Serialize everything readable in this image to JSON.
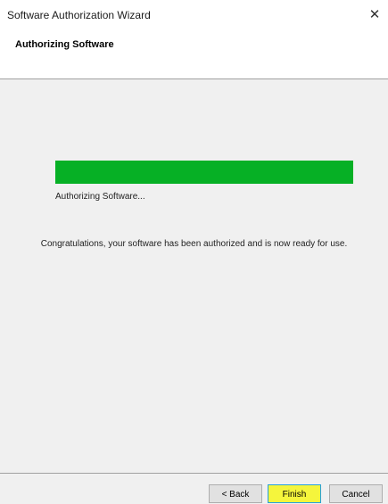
{
  "window": {
    "title": "Software Authorization Wizard",
    "close_glyph": "✕"
  },
  "header": {
    "title": "Authorizing Software"
  },
  "progress": {
    "value_percent": 100,
    "fill_color": "#06b025"
  },
  "status": {
    "text": "Authorizing Software..."
  },
  "message": {
    "text": "Congratulations, your software has been authorized and is now ready for use."
  },
  "buttons": {
    "back_label": "< Back",
    "finish_label": "Finish",
    "cancel_label": "Cancel",
    "finish_highlight_color": "#f5f53c"
  }
}
